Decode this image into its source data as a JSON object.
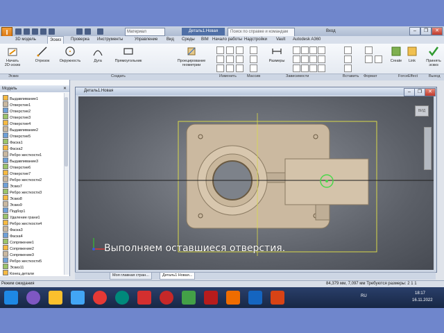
{
  "title_bar": {
    "material": "Материал",
    "document_title": "Деталь1.Новая",
    "help_search_placeholder": "Поиск по справке и командам",
    "user": "Вход"
  },
  "tabs": [
    {
      "label": "3D модель"
    },
    {
      "label": "Эскиз"
    },
    {
      "label": "Проверка"
    },
    {
      "label": "Инструменты"
    },
    {
      "label": "Управление"
    },
    {
      "label": "Вид"
    },
    {
      "label": "Среды"
    },
    {
      "label": "BIM"
    },
    {
      "label": "Начало работы"
    },
    {
      "label": "Надстройки"
    },
    {
      "label": "Vault"
    },
    {
      "label": "Autodesk A360"
    }
  ],
  "ribbon": {
    "buttons": {
      "start_sketch": "Начать 2D-эскиз",
      "line": "Отрезок",
      "circle": "Окружность",
      "arc": "Дуга",
      "rectangle": "Прямоугольник",
      "project_geometry": "Проецирование геометрии",
      "dimension": "Размеры",
      "create": "Create",
      "link": "Link",
      "finish_sketch": "Принять эскиз"
    },
    "groups": {
      "sketch": "Эскиз",
      "create": "Создать",
      "modify": "Изменить",
      "array": "Массив",
      "constrain": "Зависимости",
      "insert": "Вставить",
      "format": "Формат",
      "fusion": "ForceEffect",
      "exit": "Выход"
    }
  },
  "browser": {
    "header": "Модель",
    "items": [
      "Выдавливание1",
      "Отверстие1",
      "Отверстие2",
      "Отверстие3",
      "Отверстие4",
      "Выдавливание2",
      "Отверстие5",
      "Фаска1",
      "Фаска2",
      "Ребро жесткости1",
      "Выдавливание3",
      "Отверстие6",
      "Отверстие7",
      "Ребро жесткости2",
      "Эскиз7",
      "Ребро жесткости3",
      "Эскиз8",
      "Эскиз9",
      "Подбор1",
      "Удаление грани1",
      "Ребро жесткости4",
      "Фаска3",
      "Фаска4",
      "Сопряжение1",
      "Сопряжение2",
      "Сопряжение3",
      "Ребро жесткости5",
      "Эскиз11",
      "Конец детали"
    ]
  },
  "graphics": {
    "window_title": "Деталь1.Новая",
    "caption": "Выполняем оставшиеся отверстия."
  },
  "doc_tabs": [
    {
      "label": "Моя главная стран..."
    },
    {
      "label": "Деталь1 Новая..."
    }
  ],
  "status": {
    "left": "Режим ожидания",
    "right": "84,379 мм, 7,097 мм  Требуются размеры: 2  1  1"
  },
  "tray": {
    "lang": "RU",
    "time": "18:17",
    "date": "16.11.2022"
  },
  "colors": {
    "accent": "#3c6fd1",
    "desktop": "#6f86cc"
  }
}
